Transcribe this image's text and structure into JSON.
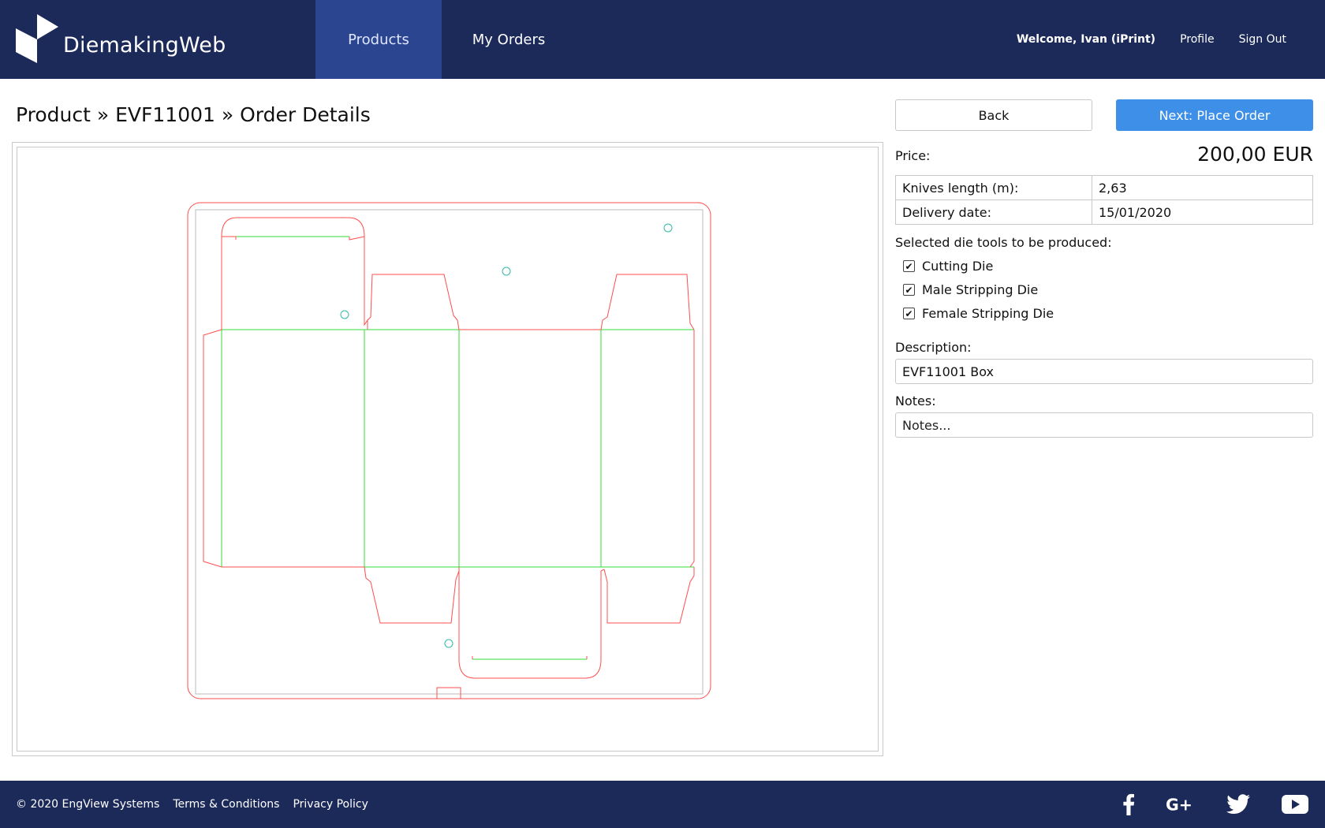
{
  "brand": {
    "name": "DiemakingWeb"
  },
  "nav": {
    "tabs": [
      {
        "label": "Products",
        "active": true
      },
      {
        "label": "My Orders",
        "active": false
      }
    ]
  },
  "user": {
    "welcome": "Welcome, Ivan (iPrint)",
    "profile": "Profile",
    "signout": "Sign Out"
  },
  "page": {
    "breadcrumb": "Product » EVF11001 » Order Details"
  },
  "actions": {
    "back": "Back",
    "next": "Next: Place Order"
  },
  "order": {
    "price_label": "Price:",
    "price_value": "200,00 EUR",
    "details": [
      {
        "label": "Knives length (m):",
        "value": "2,63"
      },
      {
        "label": "Delivery date:",
        "value": "15/01/2020"
      }
    ],
    "tools_title": "Selected die tools to be produced:",
    "tools": [
      {
        "label": "Cutting Die",
        "checked": true
      },
      {
        "label": "Male Stripping Die",
        "checked": true
      },
      {
        "label": "Female Stripping Die",
        "checked": true
      }
    ],
    "description_label": "Description:",
    "description_value": "EVF11001 Box",
    "notes_label": "Notes:",
    "notes_placeholder": "Notes..."
  },
  "footer": {
    "copyright": "© 2020 EngView Systems",
    "terms": "Terms & Conditions",
    "privacy": "Privacy Policy",
    "social_icons": [
      "facebook-icon",
      "google-plus-icon",
      "twitter-icon",
      "youtube-icon"
    ]
  },
  "colors": {
    "header": "#1c2a5a",
    "active_tab": "#2b4591",
    "primary_button": "#3d8fe8",
    "cut_line": "#ff4d4d",
    "crease_line": "#33dd33"
  }
}
